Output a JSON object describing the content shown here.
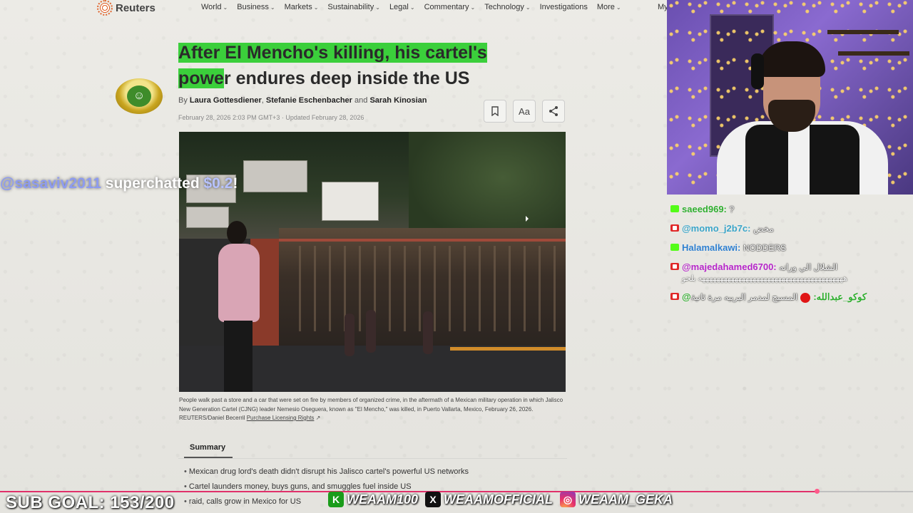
{
  "site": {
    "brand": "Reuters",
    "corner_text": "",
    "nav": [
      {
        "label": "World",
        "has_menu": true
      },
      {
        "label": "Business",
        "has_menu": true
      },
      {
        "label": "Markets",
        "has_menu": true
      },
      {
        "label": "Sustainability",
        "has_menu": true
      },
      {
        "label": "Legal",
        "has_menu": true
      },
      {
        "label": "Commentary",
        "has_menu": true
      },
      {
        "label": "Technology",
        "has_menu": true
      },
      {
        "label": "Investigations",
        "has_menu": false
      },
      {
        "label": "More",
        "has_menu": true
      }
    ],
    "nav_cut": "My"
  },
  "article": {
    "headline_highlight_1": "After El Mencho's killing, his cartel's",
    "headline_highlight_2": "powe",
    "headline_rest": "r endures deep inside the US",
    "by": "By",
    "author_1": "Laura Gottesdiener",
    "author_2": "Stefanie Eschenbacher",
    "and": "and",
    "author_3": "Sarah Kinosian",
    "date": "February 28, 2026 2:03 PM GMT+3 · Updated February 28, 2026",
    "tools": {
      "bookmark_icon": "bookmark-icon",
      "text_size_label": "Aa",
      "share_icon": "share-icon"
    },
    "caption": "People walk past a store and a car that were set on fire by members of organized crime, in the aftermath of a Mexican military operation in which Jalisco New Generation Cartel (CJNG) leader Nemesio Oseguera, known as \"El Mencho,\" was killed, in Puerto Vallarta, Mexico, February 26, 2026. REUTERS/Daniel Becerril",
    "caption_link": "Purchase Licensing Rights",
    "summary_title": "Summary",
    "bullets": [
      "Mexican drug lord's death didn't disrupt his Jalisco cartel's powerful US networks",
      "Cartel launders money, buys guns, and smuggles fuel inside US",
      "raid, calls grow in Mexico for US"
    ]
  },
  "superchat": {
    "user": "@sasaviv2011",
    "text": " superchatted ",
    "amount": "$0.2",
    "suffix": "!"
  },
  "chat": [
    {
      "platform": "kick",
      "user": "saeed969:",
      "user_color": "#2fae2f",
      "message": "?"
    },
    {
      "platform": "youtube",
      "user": "@momo_j2b7c:",
      "user_color": "#3aa5c8",
      "message": "مخض"
    },
    {
      "platform": "kick",
      "user": "Halamalkawi:",
      "user_color": "#2e7fcf",
      "message": "NODDERS"
    },
    {
      "platform": "youtube",
      "user": "@majedahamed6700:",
      "user_color": "#b525c8",
      "message": "الشلال الي ورانه",
      "message2": "ههههههههههههههههههههههههههههههههههههههههه بلحو"
    },
    {
      "platform": "youtube",
      "user": "@كوكو_عبدالله:",
      "user_color": "#2fae2f",
      "message": "المسيح لمدمر البربيه مرة ثانية"
    }
  ],
  "bottom": {
    "sub_goal": "SUB GOAL: 153/200",
    "sub_current": 153,
    "sub_target": 200,
    "socials": [
      {
        "icon": "kick-icon",
        "glyph": "K",
        "handle": "WEAAM100"
      },
      {
        "icon": "x-icon",
        "glyph": "X",
        "handle": "WEAAMOFFICIAL"
      },
      {
        "icon": "instagram-icon",
        "glyph": "◎",
        "handle": "WEAAM_GEKA"
      }
    ]
  },
  "colors": {
    "highlight": "#3bcf3b",
    "superchat_user": "#8d9bf0",
    "progress": "#e0306a"
  }
}
